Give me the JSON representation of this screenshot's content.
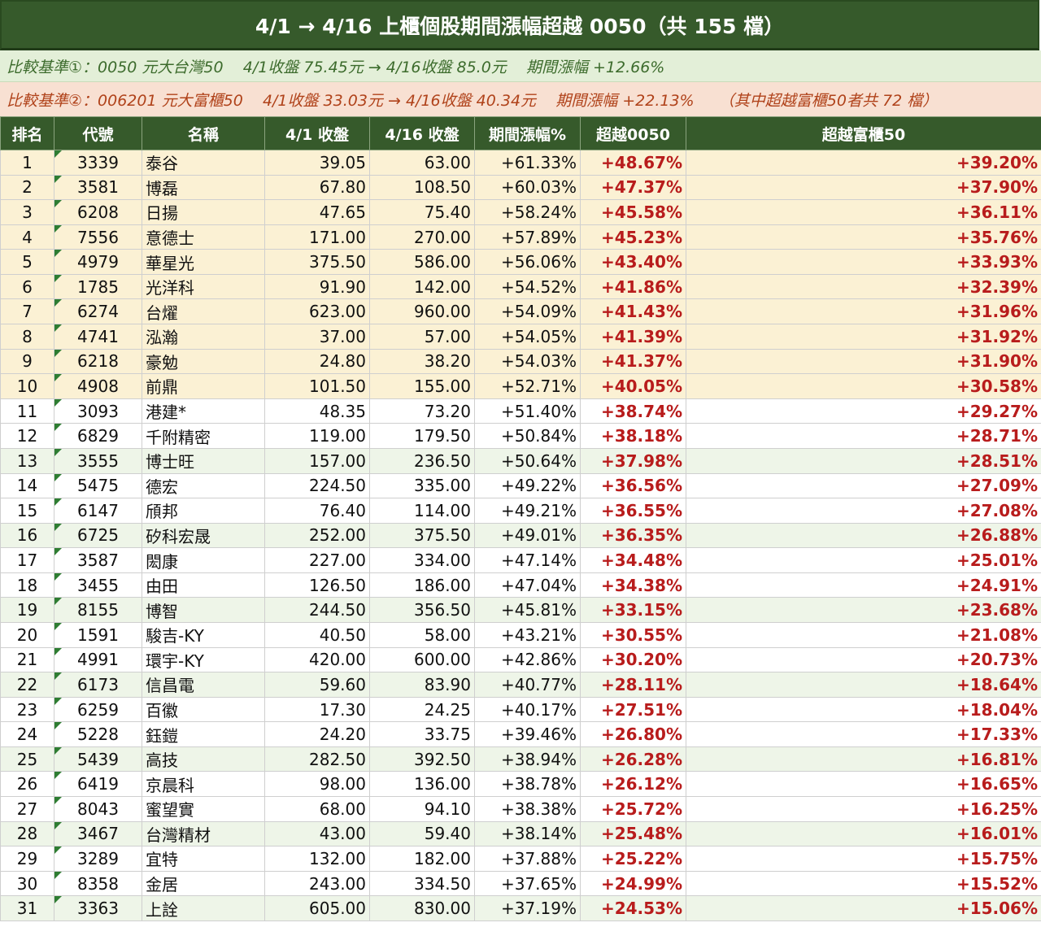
{
  "title": "4/1 → 4/16 上櫃個股期間漲幅超越 0050（共 155 檔）",
  "basis1": "比較基準①：0050 元大台灣50    4/1收盤 75.45元 → 4/16收盤 85.0元    期間漲幅 +12.66%",
  "basis2": "比較基準②：006201 元大富櫃50    4/1收盤 33.03元 → 4/16收盤 40.34元    期間漲幅 +22.13%     （其中超越富櫃50者共 72 檔）",
  "colors": {
    "header_bg": "#365a2b",
    "top10_bg": "#fbf1d4",
    "alt_bg": "#eef5e8",
    "red": "#b81c1c"
  },
  "headers": [
    "排名",
    "代號",
    "名稱",
    "4/1 收盤",
    "4/16 收盤",
    "期間漲幅%",
    "超越0050",
    "超越富櫃50"
  ],
  "rows": [
    [
      "1",
      "3339",
      "泰谷",
      "39.05",
      "63.00",
      "+61.33%",
      "+48.67%",
      "+39.20%"
    ],
    [
      "2",
      "3581",
      "博磊",
      "67.80",
      "108.50",
      "+60.03%",
      "+47.37%",
      "+37.90%"
    ],
    [
      "3",
      "6208",
      "日揚",
      "47.65",
      "75.40",
      "+58.24%",
      "+45.58%",
      "+36.11%"
    ],
    [
      "4",
      "7556",
      "意德士",
      "171.00",
      "270.00",
      "+57.89%",
      "+45.23%",
      "+35.76%"
    ],
    [
      "5",
      "4979",
      "華星光",
      "375.50",
      "586.00",
      "+56.06%",
      "+43.40%",
      "+33.93%"
    ],
    [
      "6",
      "1785",
      "光洋科",
      "91.90",
      "142.00",
      "+54.52%",
      "+41.86%",
      "+32.39%"
    ],
    [
      "7",
      "6274",
      "台燿",
      "623.00",
      "960.00",
      "+54.09%",
      "+41.43%",
      "+31.96%"
    ],
    [
      "8",
      "4741",
      "泓瀚",
      "37.00",
      "57.00",
      "+54.05%",
      "+41.39%",
      "+31.92%"
    ],
    [
      "9",
      "6218",
      "豪勉",
      "24.80",
      "38.20",
      "+54.03%",
      "+41.37%",
      "+31.90%"
    ],
    [
      "10",
      "4908",
      "前鼎",
      "101.50",
      "155.00",
      "+52.71%",
      "+40.05%",
      "+30.58%"
    ],
    [
      "11",
      "3093",
      "港建*",
      "48.35",
      "73.20",
      "+51.40%",
      "+38.74%",
      "+29.27%"
    ],
    [
      "12",
      "6829",
      "千附精密",
      "119.00",
      "179.50",
      "+50.84%",
      "+38.18%",
      "+28.71%"
    ],
    [
      "13",
      "3555",
      "博士旺",
      "157.00",
      "236.50",
      "+50.64%",
      "+37.98%",
      "+28.51%"
    ],
    [
      "14",
      "5475",
      "德宏",
      "224.50",
      "335.00",
      "+49.22%",
      "+36.56%",
      "+27.09%"
    ],
    [
      "15",
      "6147",
      "頎邦",
      "76.40",
      "114.00",
      "+49.21%",
      "+36.55%",
      "+27.08%"
    ],
    [
      "16",
      "6725",
      "矽科宏晟",
      "252.00",
      "375.50",
      "+49.01%",
      "+36.35%",
      "+26.88%"
    ],
    [
      "17",
      "3587",
      "閎康",
      "227.00",
      "334.00",
      "+47.14%",
      "+34.48%",
      "+25.01%"
    ],
    [
      "18",
      "3455",
      "由田",
      "126.50",
      "186.00",
      "+47.04%",
      "+34.38%",
      "+24.91%"
    ],
    [
      "19",
      "8155",
      "博智",
      "244.50",
      "356.50",
      "+45.81%",
      "+33.15%",
      "+23.68%"
    ],
    [
      "20",
      "1591",
      "駿吉-KY",
      "40.50",
      "58.00",
      "+43.21%",
      "+30.55%",
      "+21.08%"
    ],
    [
      "21",
      "4991",
      "環宇-KY",
      "420.00",
      "600.00",
      "+42.86%",
      "+30.20%",
      "+20.73%"
    ],
    [
      "22",
      "6173",
      "信昌電",
      "59.60",
      "83.90",
      "+40.77%",
      "+28.11%",
      "+18.64%"
    ],
    [
      "23",
      "6259",
      "百徽",
      "17.30",
      "24.25",
      "+40.17%",
      "+27.51%",
      "+18.04%"
    ],
    [
      "24",
      "5228",
      "鈺鎧",
      "24.20",
      "33.75",
      "+39.46%",
      "+26.80%",
      "+17.33%"
    ],
    [
      "25",
      "5439",
      "高技",
      "282.50",
      "392.50",
      "+38.94%",
      "+26.28%",
      "+16.81%"
    ],
    [
      "26",
      "6419",
      "京晨科",
      "98.00",
      "136.00",
      "+38.78%",
      "+26.12%",
      "+16.65%"
    ],
    [
      "27",
      "8043",
      "蜜望實",
      "68.00",
      "94.10",
      "+38.38%",
      "+25.72%",
      "+16.25%"
    ],
    [
      "28",
      "3467",
      "台灣精材",
      "43.00",
      "59.40",
      "+38.14%",
      "+25.48%",
      "+16.01%"
    ],
    [
      "29",
      "3289",
      "宜特",
      "132.00",
      "182.00",
      "+37.88%",
      "+25.22%",
      "+15.75%"
    ],
    [
      "30",
      "8358",
      "金居",
      "243.00",
      "334.50",
      "+37.65%",
      "+24.99%",
      "+15.52%"
    ],
    [
      "31",
      "3363",
      "上詮",
      "605.00",
      "830.00",
      "+37.19%",
      "+24.53%",
      "+15.06%"
    ]
  ]
}
